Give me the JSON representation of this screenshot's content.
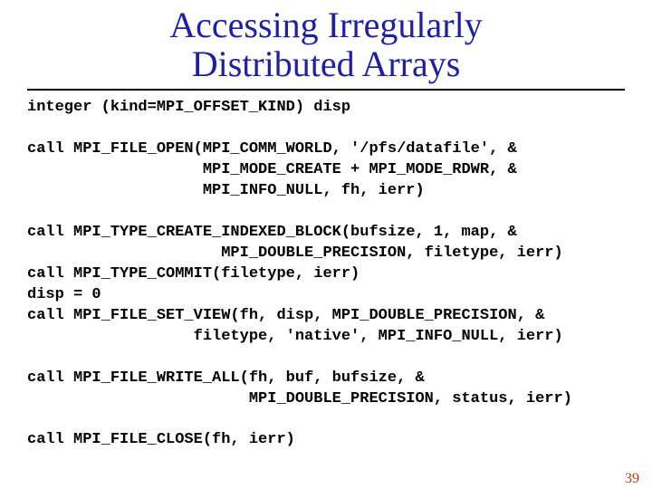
{
  "title_line1": "Accessing Irregularly",
  "title_line2": "Distributed Arrays",
  "code": {
    "l1": "integer (kind=MPI_OFFSET_KIND) disp",
    "l2": "",
    "l3": "call MPI_FILE_OPEN(MPI_COMM_WORLD, '/pfs/datafile', &",
    "l4": "                   MPI_MODE_CREATE + MPI_MODE_RDWR, &",
    "l5": "                   MPI_INFO_NULL, fh, ierr)",
    "l6": "",
    "l7": "call MPI_TYPE_CREATE_INDEXED_BLOCK(bufsize, 1, map, &",
    "l8": "                     MPI_DOUBLE_PRECISION, filetype, ierr)",
    "l9": "call MPI_TYPE_COMMIT(filetype, ierr)",
    "l10": "disp = 0",
    "l11": "call MPI_FILE_SET_VIEW(fh, disp, MPI_DOUBLE_PRECISION, &",
    "l12": "                  filetype, 'native', MPI_INFO_NULL, ierr)",
    "l13": "",
    "l14": "call MPI_FILE_WRITE_ALL(fh, buf, bufsize, &",
    "l15": "                        MPI_DOUBLE_PRECISION, status, ierr)",
    "l16": "",
    "l17": "call MPI_FILE_CLOSE(fh, ierr)"
  },
  "page_number": "39"
}
